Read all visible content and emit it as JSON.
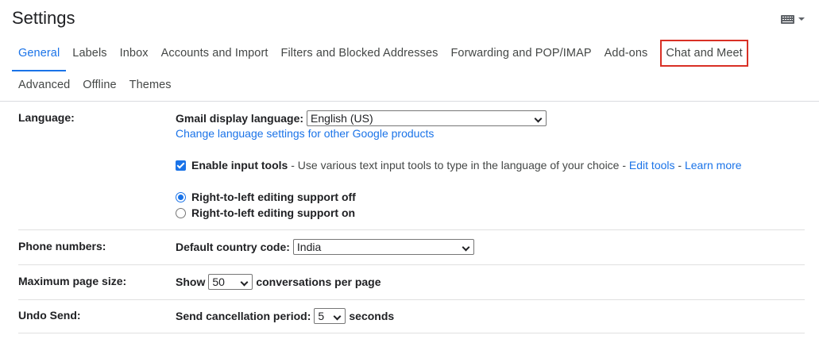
{
  "header": {
    "title": "Settings",
    "keyboard_icon": "keyboard-icon"
  },
  "tabs": {
    "row1": [
      {
        "label": "General",
        "active": true
      },
      {
        "label": "Labels"
      },
      {
        "label": "Inbox"
      },
      {
        "label": "Accounts and Import"
      },
      {
        "label": "Filters and Blocked Addresses"
      },
      {
        "label": "Forwarding and POP/IMAP"
      },
      {
        "label": "Add-ons"
      },
      {
        "label": "Chat and Meet",
        "highlighted": true
      }
    ],
    "row2": [
      {
        "label": "Advanced"
      },
      {
        "label": "Offline"
      },
      {
        "label": "Themes"
      }
    ]
  },
  "language": {
    "label": "Language:",
    "display_label": "Gmail display language:",
    "display_value": "English (US)",
    "change_link": "Change language settings for other Google products",
    "input_tools_label": "Enable input tools",
    "input_tools_desc": " - Use various text input tools to type in the language of your choice - ",
    "edit_tools": "Edit tools",
    "sep": " - ",
    "learn_more": "Learn more",
    "rtl_off": "Right-to-left editing support off",
    "rtl_on": "Right-to-left editing support on"
  },
  "phone": {
    "label": "Phone numbers:",
    "country_label": "Default country code:",
    "country_value": "India"
  },
  "page_size": {
    "label": "Maximum page size:",
    "show": "Show",
    "value": "50",
    "suffix": "conversations per page"
  },
  "undo": {
    "label": "Undo Send:",
    "period_label": "Send cancellation period:",
    "value": "5",
    "suffix": "seconds"
  }
}
